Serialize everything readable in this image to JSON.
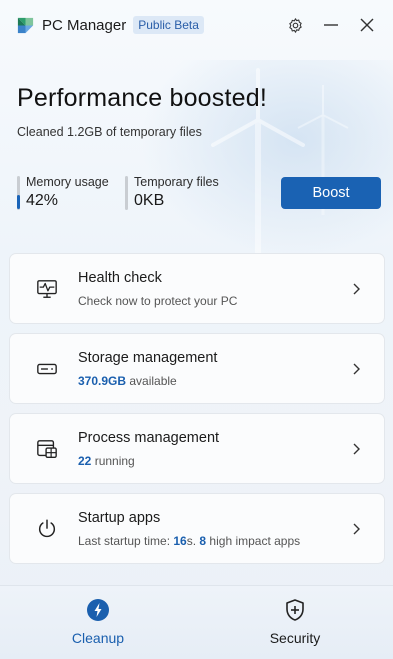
{
  "titlebar": {
    "app_title": "PC Manager",
    "badge": "Public Beta",
    "settings_icon": "gear-icon",
    "minimize_icon": "minimize-icon",
    "close_icon": "close-icon"
  },
  "hero": {
    "title": "Performance boosted!",
    "subtitle": "Cleaned 1.2GB of temporary files"
  },
  "stats": {
    "memory": {
      "label": "Memory usage",
      "value": "42%",
      "level": 0.42
    },
    "temp": {
      "label": "Temporary files",
      "value": "0KB",
      "level": 0
    }
  },
  "boost_button": "Boost",
  "cards": [
    {
      "title": "Health check",
      "sub_plain": "Check now to protect your PC",
      "icon": "pulse-monitor-icon"
    },
    {
      "title": "Storage management",
      "sub_bold": "370.9GB",
      "sub_rest": " available",
      "icon": "drive-icon"
    },
    {
      "title": "Process management",
      "sub_bold": "22",
      "sub_rest": " running",
      "icon": "process-window-icon"
    },
    {
      "title": "Startup apps",
      "sub_prefix": "Last startup time: ",
      "sub_bold1": "16",
      "sub_mid": "s. ",
      "sub_bold2": "8",
      "sub_rest": " high impact apps",
      "icon": "power-icon"
    }
  ],
  "nav": {
    "cleanup": "Cleanup",
    "security": "Security"
  },
  "colors": {
    "accent": "#1a62b3",
    "highlight_text": "#1a5fae"
  }
}
